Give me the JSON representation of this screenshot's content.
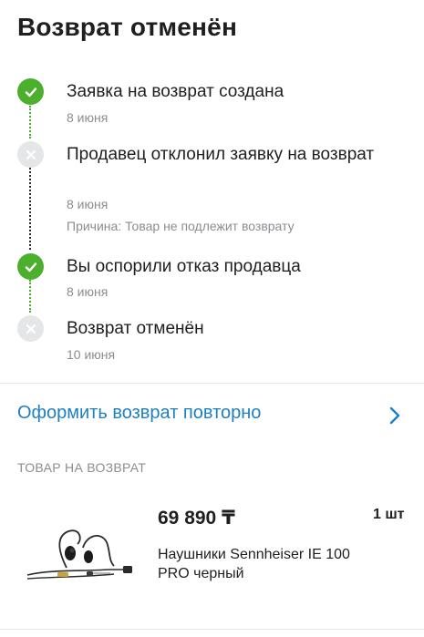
{
  "header": {
    "title": "Возврат отменён"
  },
  "timeline": {
    "steps": [
      {
        "label": "Заявка на возврат создана",
        "date": "8 июня",
        "status": "done",
        "icon": "check-icon"
      },
      {
        "label": "Продавец отклонил заявку на возврат",
        "date": "8 июня",
        "reason": "Причина: Товар не подлежит возврату",
        "status": "cancelled",
        "icon": "close-icon"
      },
      {
        "label": "Вы оспорили отказ продавца",
        "date": "8 июня",
        "status": "done",
        "icon": "check-icon"
      },
      {
        "label": "Возврат отменён",
        "date": "10 июня",
        "status": "cancelled",
        "icon": "close-icon"
      }
    ]
  },
  "action": {
    "label": "Оформить возврат повторно",
    "icon": "chevron-right-icon"
  },
  "returned_item": {
    "section_title": "ТОВАР НА ВОЗВРАТ",
    "price": "69 890 ₸",
    "quantity": "1 шт",
    "name": "Наушники Sennheiser IE 100 PRO черный",
    "image": "earphones-image"
  },
  "colors": {
    "done": "#4caf2e",
    "cancelled": "#e4e6e8",
    "link": "#1e7fc1",
    "muted_text": "#8a8d91"
  }
}
